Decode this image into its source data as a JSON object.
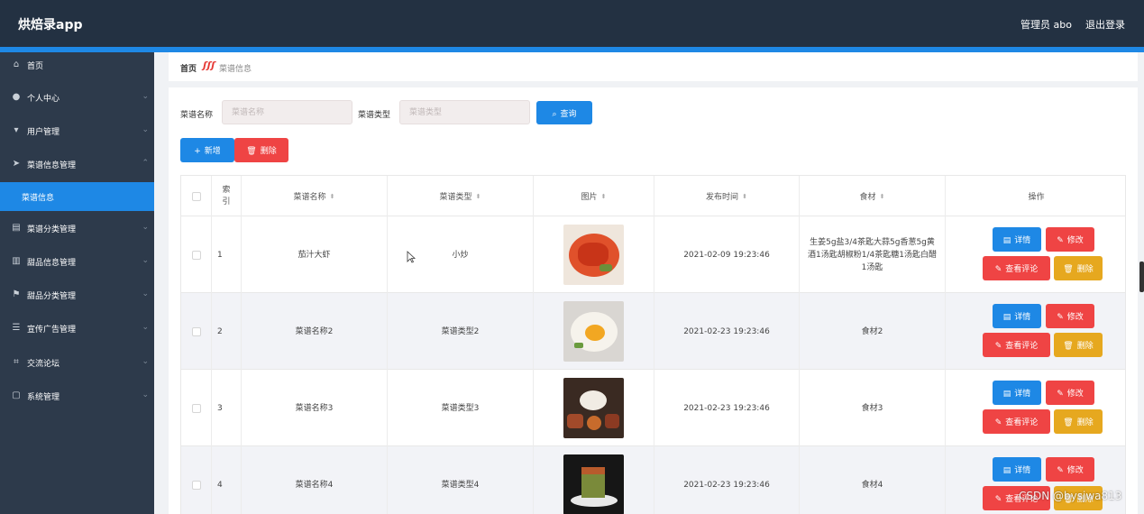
{
  "app": {
    "title": "烘焙录app",
    "admin_label": "管理员 abo",
    "logout_label": "退出登录"
  },
  "sidebar": {
    "items": [
      {
        "label": "首页",
        "icon": "home-icon",
        "has_arrow": false
      },
      {
        "label": "个人中心",
        "icon": "user-icon",
        "has_arrow": true
      },
      {
        "label": "用户管理",
        "icon": "users-icon",
        "has_arrow": true
      },
      {
        "label": "菜谱信息管理",
        "icon": "send-icon",
        "has_arrow": true,
        "expanded": true
      },
      {
        "label": "菜谱分类管理",
        "icon": "list-icon",
        "has_arrow": true
      },
      {
        "label": "甜品信息管理",
        "icon": "chart-icon",
        "has_arrow": true
      },
      {
        "label": "甜品分类管理",
        "icon": "flag-icon",
        "has_arrow": true
      },
      {
        "label": "宣传广告管理",
        "icon": "sliders-icon",
        "has_arrow": true
      },
      {
        "label": "交流论坛",
        "icon": "crop-icon",
        "has_arrow": true
      },
      {
        "label": "系统管理",
        "icon": "chat-icon",
        "has_arrow": true
      }
    ],
    "active_sub": "菜谱信息"
  },
  "breadcrumb": {
    "home": "首页",
    "current": "菜谱信息"
  },
  "search": {
    "name_label": "菜谱名称",
    "name_placeholder": "菜谱名称",
    "type_label": "菜谱类型",
    "type_placeholder": "菜谱类型",
    "query_button": "查询"
  },
  "toolbar": {
    "add_button": "新增",
    "delete_button": "删除"
  },
  "table": {
    "headers": {
      "index": "索\n引",
      "name": "菜谱名称",
      "type": "菜谱类型",
      "image": "图片",
      "time": "发布时间",
      "ingredients": "食材",
      "actions": "操作"
    },
    "rows": [
      {
        "index": "1",
        "name": "茄汁大虾",
        "type": "小炒",
        "time": "2021-02-09 19:23:46",
        "ingredients": "生姜5g盐3/4茶匙大蒜5g香葱5g黄酒1汤匙胡椒粉1/4茶匙糖1汤匙白醋1汤匙",
        "image": "shrimp"
      },
      {
        "index": "2",
        "name": "菜谱名称2",
        "type": "菜谱类型2",
        "time": "2021-02-23 19:23:46",
        "ingredients": "食材2",
        "image": "egg"
      },
      {
        "index": "3",
        "name": "菜谱名称3",
        "type": "菜谱类型3",
        "time": "2021-02-23 19:23:46",
        "ingredients": "食材3",
        "image": "platter"
      },
      {
        "index": "4",
        "name": "菜谱名称4",
        "type": "菜谱类型4",
        "time": "2021-02-23 19:23:46",
        "ingredients": "食材4",
        "image": "dessert"
      }
    ],
    "row_actions": {
      "detail": "详情",
      "edit": "修改",
      "comments": "查看评论",
      "delete": "删除"
    }
  },
  "watermark": "CSDN @bysjwa813",
  "colors": {
    "topbar": "#233142",
    "sidebar": "#2d3a4b",
    "accent": "#1e88e5",
    "danger": "#ef4444",
    "warning": "#e6a81f"
  }
}
